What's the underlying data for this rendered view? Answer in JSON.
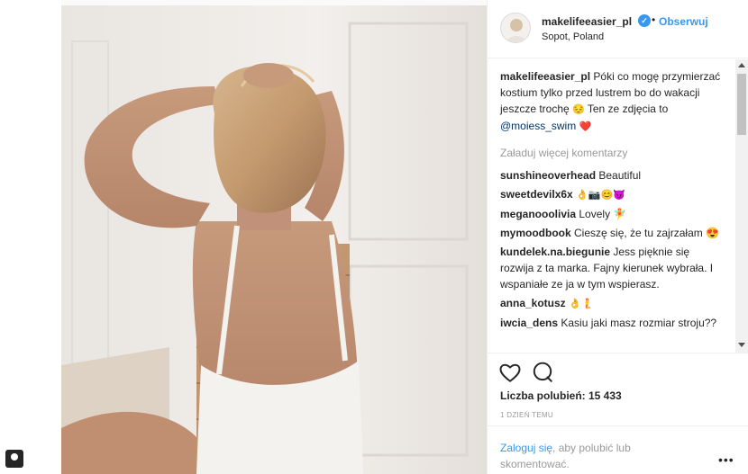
{
  "post": {
    "username": "makelifeeasier_pl",
    "follow_label": "Obserwuj",
    "separator": "•",
    "location": "Sopot, Poland",
    "verified": true
  },
  "caption": {
    "username": "makelifeeasier_pl",
    "text_part1": "Póki co mogę przymierzać kostium tylko przed lustrem bo do wakacji jeszcze trochę",
    "emoji_1": "😔",
    "text_part2": "Ten ze zdjęcia to",
    "mention": "@moiess_swim",
    "emoji_2": "❤️"
  },
  "load_more_label": "Załaduj więcej komentarzy",
  "comments": [
    {
      "username": "sunshineoverhead",
      "text": "Beautiful"
    },
    {
      "username": "sweetdevilx6x",
      "text": "👌📷😊😈"
    },
    {
      "username": "meganooolivia",
      "text": "Lovely 🧚"
    },
    {
      "username": "mymoodbook",
      "text": "Cieszę się, że tu zajrzałam 😍"
    },
    {
      "username": "kundelek.na.biegunie",
      "text": "Jess pięknie się rozwija z ta marka. Fajny kierunek wybrała. I wspaniałe ze ja w tym wspierasz."
    },
    {
      "username": "anna_kotusz",
      "text": "👌🧜"
    },
    {
      "username": "iwcia_dens",
      "text": "Kasiu jaki masz rozmiar stroju??"
    }
  ],
  "actions": {
    "likes_label": "Liczba polubień: 15 433",
    "time_label": "1 DZIEŃ TEMU",
    "heart_icon": "heart-icon",
    "comment_icon": "comment-icon"
  },
  "login": {
    "link_label": "Zaloguj się",
    "rest_text": ", aby polubić lub skomentować.",
    "more_label": "•••"
  },
  "colors": {
    "link": "#3897f0",
    "muted": "#999999",
    "text": "#262626",
    "heart": "#ed4956"
  }
}
